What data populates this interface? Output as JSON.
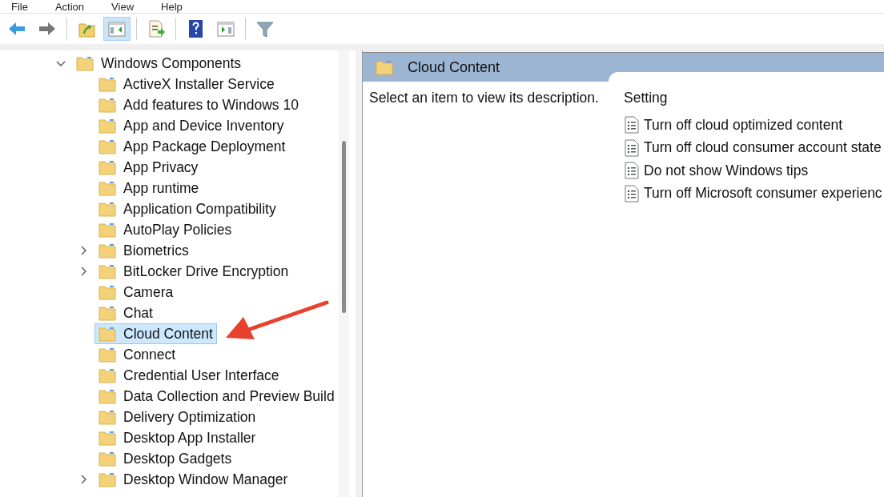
{
  "menu": [
    "File",
    "Action",
    "View",
    "Help"
  ],
  "toolbar": [
    {
      "kind": "back",
      "pressed": false
    },
    {
      "kind": "forward",
      "pressed": false
    },
    {
      "kind": "sep"
    },
    {
      "kind": "up",
      "pressed": false
    },
    {
      "kind": "tree",
      "pressed": true
    },
    {
      "kind": "sep"
    },
    {
      "kind": "export",
      "pressed": false
    },
    {
      "kind": "sep"
    },
    {
      "kind": "help",
      "pressed": false
    },
    {
      "kind": "pane",
      "pressed": false
    },
    {
      "kind": "sep"
    },
    {
      "kind": "filter",
      "pressed": false
    }
  ],
  "tree": [
    {
      "label": "Windows Components",
      "expanded": true,
      "selected": false,
      "children": [
        {
          "label": "ActiveX Installer Service",
          "selected": false
        },
        {
          "label": "Add features to Windows 10",
          "selected": false
        },
        {
          "label": "App and Device Inventory",
          "selected": false
        },
        {
          "label": "App Package Deployment",
          "selected": false
        },
        {
          "label": "App Privacy",
          "selected": false
        },
        {
          "label": "App runtime",
          "selected": false
        },
        {
          "label": "Application Compatibility",
          "selected": false
        },
        {
          "label": "AutoPlay Policies",
          "selected": false
        },
        {
          "label": "Biometrics",
          "selected": false,
          "expanded": false
        },
        {
          "label": "BitLocker Drive Encryption",
          "selected": false,
          "expanded": false
        },
        {
          "label": "Camera",
          "selected": false
        },
        {
          "label": "Chat",
          "selected": false
        },
        {
          "label": "Cloud Content",
          "selected": true
        },
        {
          "label": "Connect",
          "selected": false
        },
        {
          "label": "Credential User Interface",
          "selected": false
        },
        {
          "label": "Data Collection and Preview Build",
          "selected": false
        },
        {
          "label": "Delivery Optimization",
          "selected": false
        },
        {
          "label": "Desktop App Installer",
          "selected": false
        },
        {
          "label": "Desktop Gadgets",
          "selected": false
        },
        {
          "label": "Desktop Window Manager",
          "selected": false,
          "expanded": false
        }
      ]
    }
  ],
  "details": {
    "title": "Cloud Content",
    "description": "Select an item to view its description.",
    "column": "Setting",
    "settings": [
      {
        "label": "Turn off cloud optimized content"
      },
      {
        "label": "Turn off cloud consumer account state"
      },
      {
        "label": "Do not show Windows tips"
      },
      {
        "label": "Turn off Microsoft consumer experienc"
      }
    ]
  }
}
